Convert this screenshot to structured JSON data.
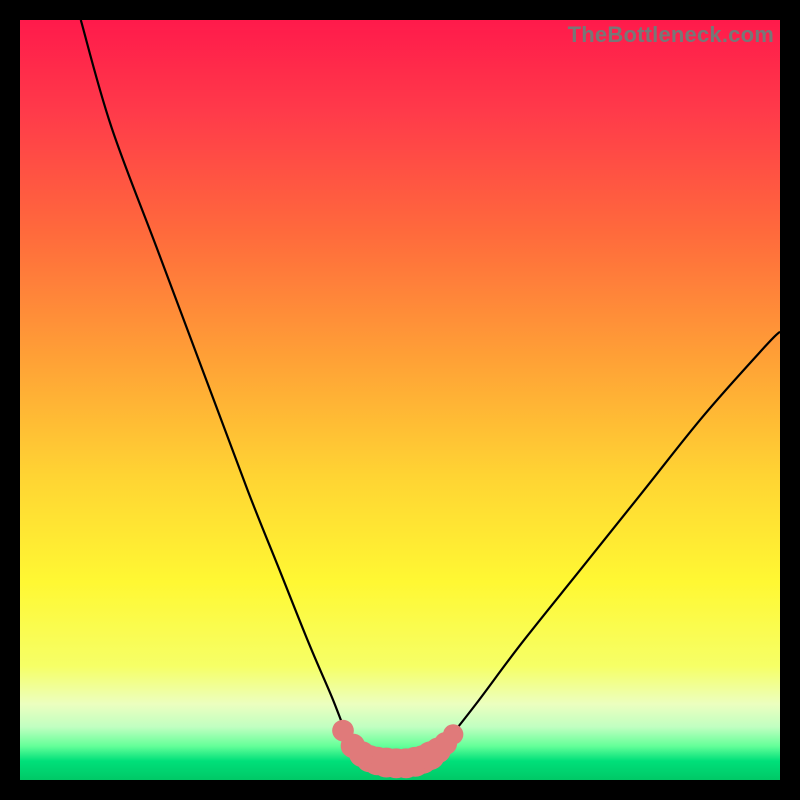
{
  "watermark": {
    "text": "TheBottleneck.com"
  },
  "colors": {
    "black": "#000000",
    "curve": "#000000",
    "marker_fill": "#e07a7a",
    "marker_stroke": "#c96a6a",
    "gradient_stops": [
      {
        "offset": 0.0,
        "color": "#ff1a4b"
      },
      {
        "offset": 0.12,
        "color": "#ff3a4a"
      },
      {
        "offset": 0.28,
        "color": "#ff6a3c"
      },
      {
        "offset": 0.45,
        "color": "#ffa236"
      },
      {
        "offset": 0.6,
        "color": "#ffd433"
      },
      {
        "offset": 0.74,
        "color": "#fff833"
      },
      {
        "offset": 0.85,
        "color": "#f6ff66"
      },
      {
        "offset": 0.9,
        "color": "#ecffbf"
      },
      {
        "offset": 0.93,
        "color": "#c1ffc1"
      },
      {
        "offset": 0.955,
        "color": "#66ff99"
      },
      {
        "offset": 0.975,
        "color": "#00e07a"
      },
      {
        "offset": 1.0,
        "color": "#00c866"
      }
    ]
  },
  "chart_data": {
    "type": "line",
    "title": "",
    "xlabel": "",
    "ylabel": "",
    "xlim": [
      0,
      100
    ],
    "ylim": [
      0,
      100
    ],
    "grid": false,
    "legend": false,
    "series": [
      {
        "name": "bottleneck-curve",
        "x": [
          8,
          12,
          18,
          24,
          30,
          34,
          38,
          41,
          43,
          44.5,
          46,
          48,
          50,
          52,
          54,
          56,
          60,
          66,
          74,
          82,
          90,
          98,
          100
        ],
        "y": [
          100,
          86,
          70,
          54,
          38,
          28,
          18,
          11,
          6,
          3.5,
          2.5,
          2.2,
          2.2,
          2.5,
          3.2,
          5,
          10,
          18,
          28,
          38,
          48,
          57,
          59
        ]
      }
    ],
    "flat_bottom": {
      "x_start": 44,
      "x_end": 55,
      "y": 2.3
    },
    "markers": {
      "name": "bottom-dots",
      "color": "#e07a7a",
      "points": [
        {
          "x": 42.5,
          "y": 6.5,
          "r": 1.0
        },
        {
          "x": 43.8,
          "y": 4.5,
          "r": 1.2
        },
        {
          "x": 45.0,
          "y": 3.4,
          "r": 1.3
        },
        {
          "x": 46.0,
          "y": 2.8,
          "r": 1.4
        },
        {
          "x": 47.0,
          "y": 2.5,
          "r": 1.5
        },
        {
          "x": 48.2,
          "y": 2.3,
          "r": 1.6
        },
        {
          "x": 49.5,
          "y": 2.2,
          "r": 1.6
        },
        {
          "x": 50.8,
          "y": 2.2,
          "r": 1.6
        },
        {
          "x": 52.0,
          "y": 2.4,
          "r": 1.6
        },
        {
          "x": 53.0,
          "y": 2.7,
          "r": 1.5
        },
        {
          "x": 54.0,
          "y": 3.2,
          "r": 1.5
        },
        {
          "x": 55.0,
          "y": 3.9,
          "r": 1.3
        },
        {
          "x": 56.0,
          "y": 4.8,
          "r": 1.1
        },
        {
          "x": 57.0,
          "y": 6.0,
          "r": 0.9
        }
      ]
    }
  }
}
